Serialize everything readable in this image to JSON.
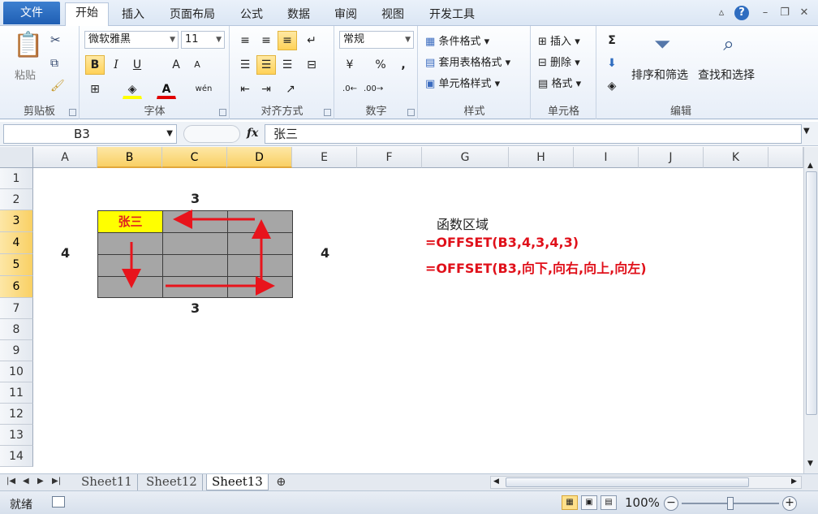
{
  "tabs": [
    {
      "label": "文件"
    },
    {
      "label": "开始"
    },
    {
      "label": "插入"
    },
    {
      "label": "页面布局"
    },
    {
      "label": "公式"
    },
    {
      "label": "数据"
    },
    {
      "label": "审阅"
    },
    {
      "label": "视图"
    },
    {
      "label": "开发工具"
    }
  ],
  "window": {
    "help": "?"
  },
  "ribbon": {
    "clipboard": {
      "paste": "粘贴",
      "group": "剪贴板"
    },
    "font": {
      "name": "微软雅黑",
      "size": "11",
      "bold": "B",
      "italic": "I",
      "underline": "U",
      "grow": "A",
      "shrink": "A",
      "wen": "wén",
      "group": "字体"
    },
    "alignment": {
      "group": "对齐方式"
    },
    "number": {
      "format": "常规",
      "percent": "%",
      "comma": ",",
      "group": "数字"
    },
    "styles": {
      "conditional": "条件格式",
      "table": "套用表格格式",
      "cell": "单元格样式",
      "group": "样式"
    },
    "cells": {
      "insert": "插入",
      "delete": "删除",
      "format": "格式",
      "group": "单元格"
    },
    "editing": {
      "sum": "Σ",
      "sort": "排序和筛选",
      "find": "查找和选择",
      "group": "编辑"
    }
  },
  "formula_bar": {
    "name_box": "B3",
    "fx": "fx",
    "content": "张三"
  },
  "grid": {
    "columns": [
      "A",
      "B",
      "C",
      "D",
      "E",
      "F",
      "G",
      "H",
      "I",
      "J",
      "K"
    ],
    "rows": [
      "1",
      "2",
      "3",
      "4",
      "5",
      "6",
      "7",
      "8",
      "9",
      "10",
      "11",
      "12",
      "13",
      "14"
    ],
    "cell_b3": "张三",
    "top_count": "3",
    "bottom_count": "3",
    "left_count": "4",
    "right_count": "4",
    "func_title": "函数区域",
    "formula1": "=OFFSET(B3,4,3,4,3)",
    "formula2": "=OFFSET(B3,向下,向右,向上,向左)",
    "arrow_color": "#e8141c"
  },
  "sheets": [
    {
      "label": "Sheet11"
    },
    {
      "label": "Sheet12"
    },
    {
      "label": "Sheet13"
    }
  ],
  "status": {
    "text": "就绪",
    "zoom": "100%"
  }
}
